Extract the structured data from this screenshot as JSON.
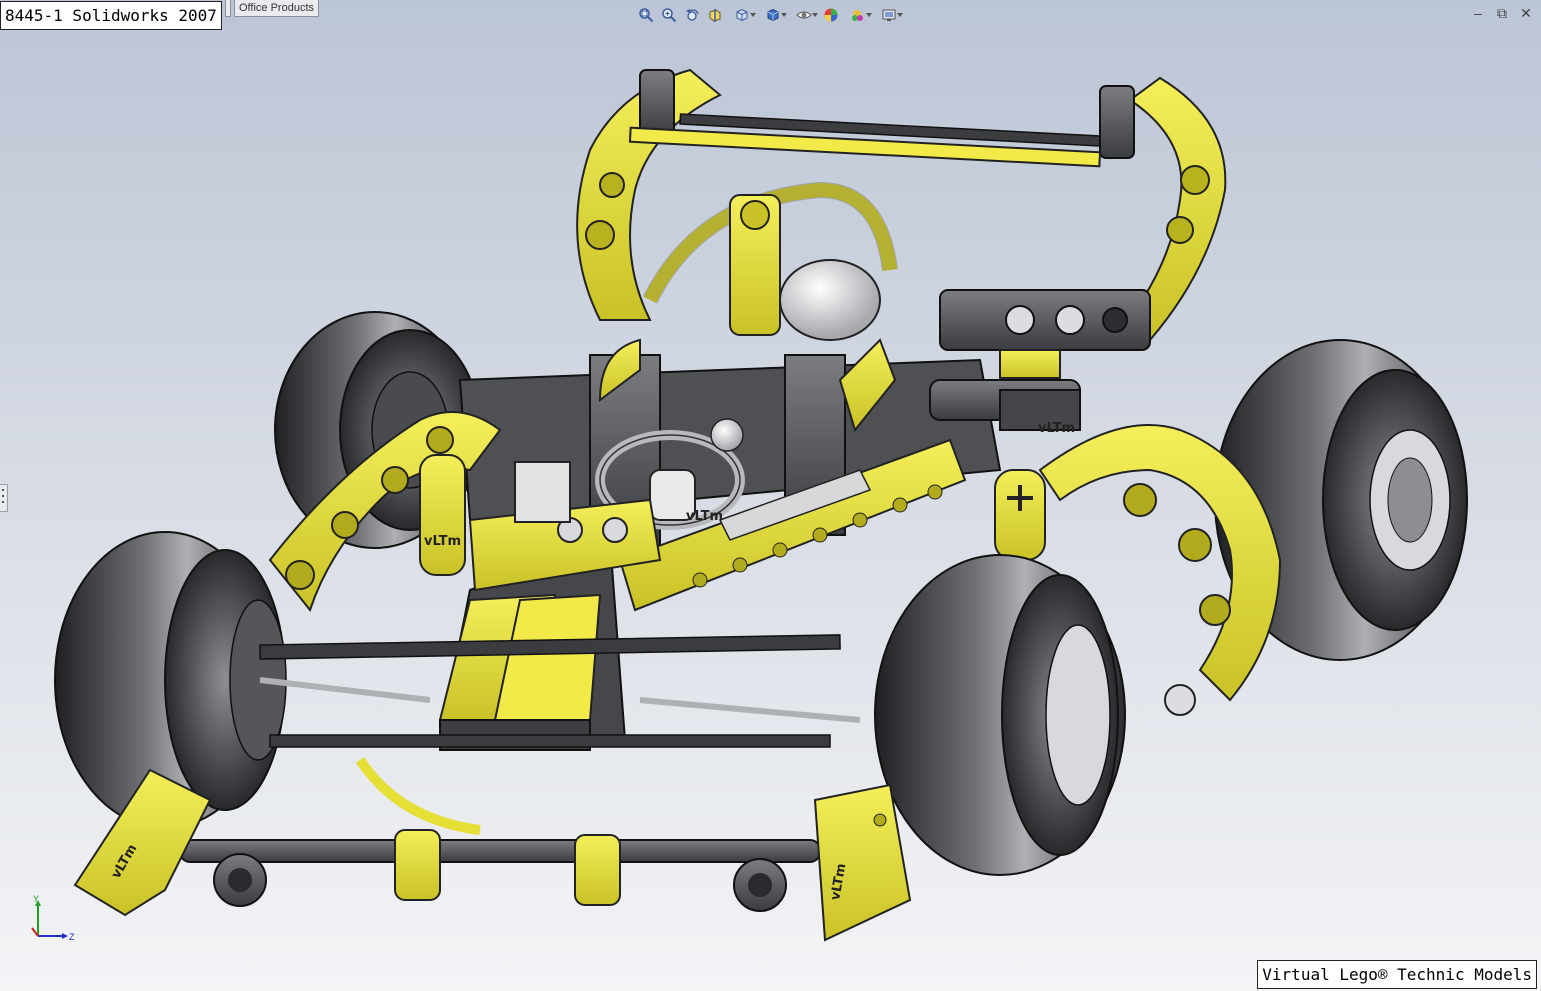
{
  "window": {
    "title_label": "8445-1 Solidworks 2007",
    "tabs": [
      {
        "label": ""
      },
      {
        "label": "Office Products"
      }
    ],
    "controls": {
      "minimize_symbol": "–",
      "restore_symbol": "⧉",
      "close_symbol": "✕"
    }
  },
  "heads_up_toolbar": {
    "buttons": [
      {
        "icon": "zoom-to-fit-icon"
      },
      {
        "icon": "zoom-to-area-icon"
      },
      {
        "icon": "previous-view-icon"
      },
      {
        "icon": "section-view-icon"
      },
      {
        "icon": "view-orientation-icon",
        "dropdown": true
      },
      {
        "icon": "display-style-icon",
        "dropdown": true
      },
      {
        "icon": "hide-show-items-icon",
        "dropdown": true
      },
      {
        "icon": "edit-appearance-icon"
      },
      {
        "icon": "apply-scene-icon",
        "dropdown": true
      },
      {
        "icon": "view-settings-icon",
        "dropdown": true
      }
    ]
  },
  "model": {
    "description_name": "lego-technic-8445-model",
    "part_labels": [
      "vLTm",
      "vLTm",
      "vLTm",
      "vLTm",
      "vLTm"
    ],
    "colors": {
      "yellow": "#e9e33a",
      "yellow_dark": "#b7b020",
      "grey": "#5d5f63",
      "grey_dark": "#2c2d30",
      "tire": "#3a3b3e",
      "light_grey": "#c9cbd0"
    }
  },
  "triad": {
    "y_label": "Y",
    "z_label": "Z",
    "x_color": "#d02020",
    "y_color": "#20a020",
    "z_color": "#2030c0"
  },
  "watermark": {
    "text": "Virtual Lego® Technic Models"
  }
}
